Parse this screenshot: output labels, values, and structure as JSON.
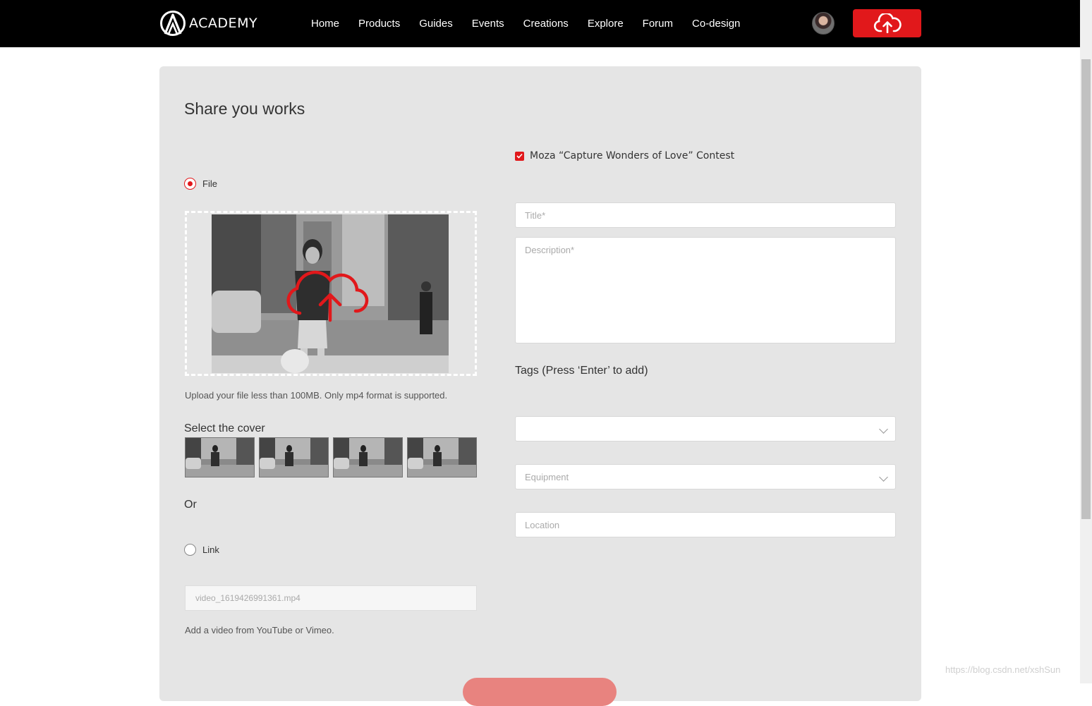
{
  "brand": {
    "logo_text": "ACADEMY"
  },
  "nav": {
    "items": [
      {
        "label": "Home"
      },
      {
        "label": "Products"
      },
      {
        "label": "Guides"
      },
      {
        "label": "Events"
      },
      {
        "label": "Creations"
      },
      {
        "label": "Explore"
      },
      {
        "label": "Forum"
      },
      {
        "label": "Co-design"
      }
    ],
    "upload_icon": "cloud-upload-icon"
  },
  "form": {
    "title": "Share you works",
    "file_option": "File",
    "upload_hint": "Upload your file less than 100MB. Only mp4 format is supported.",
    "select_cover": "Select the cover",
    "or": "Or",
    "link_option": "Link",
    "link_value": "video_1619426991361.mp4",
    "link_hint": "Add a video from YouTube or Vimeo.",
    "contest_label": "Moza “Capture Wonders of Love” Contest",
    "contest_checked": true,
    "title_placeholder": "Title*",
    "description_placeholder": "Description*",
    "tags_label": "Tags (Press ‘Enter’ to add)",
    "tags_select_value": "",
    "equipment_placeholder": "Equipment",
    "location_placeholder": "Location",
    "accent_color": "#e1181b"
  },
  "watermark": "https://blog.csdn.net/xshSun"
}
